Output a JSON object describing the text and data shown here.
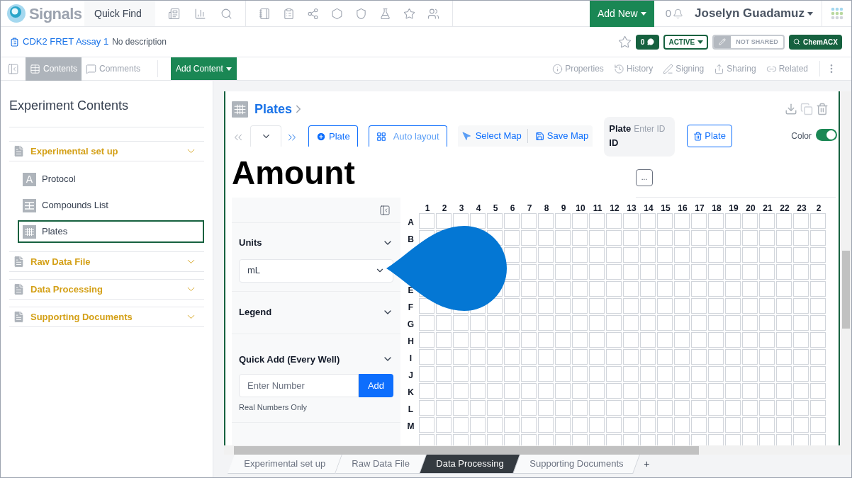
{
  "topbar": {
    "brand": "Signals",
    "quick_find": "Quick Find",
    "add_new": "Add New",
    "notifications": "0",
    "user": "Joselyn Guadamuz"
  },
  "header": {
    "title": "CDK2 FRET Assay 1",
    "description": "No description",
    "comments": "0",
    "status": "ACTIVE",
    "sharing": "NOT SHARED",
    "search_button": "ChemACX"
  },
  "toolbar": {
    "tabs": [
      {
        "label": "Contents",
        "selected": true
      },
      {
        "label": "Comments",
        "selected": false
      }
    ],
    "add_content": "Add Content",
    "actions": [
      "Properties",
      "History",
      "Signing",
      "Sharing",
      "Related"
    ]
  },
  "sidebar": {
    "title": "Experiment Contents",
    "sections": [
      {
        "label": "Experimental set up",
        "children": [
          {
            "label": "Protocol",
            "kind": "text",
            "icon": "A",
            "selected": false
          },
          {
            "label": "Compounds List",
            "kind": "table",
            "selected": false
          },
          {
            "label": "Plates",
            "kind": "plate",
            "selected": true
          }
        ]
      },
      {
        "label": "Raw Data File"
      },
      {
        "label": "Data Processing"
      },
      {
        "label": "Supporting Documents"
      }
    ]
  },
  "plates": {
    "title": "Plates",
    "add_plate": "Plate",
    "auto_layout": "Auto layout",
    "select_map": "Select Map",
    "save_map": "Save Map",
    "plate_id_label": "Plate ID",
    "plate_id_placeholder": "Enter ID",
    "delete_plate": "Plate",
    "color_toggle": {
      "label": "Color",
      "on": true
    },
    "heading": "Amount",
    "more": "...",
    "panel": {
      "units": {
        "label": "Units",
        "value": "mL"
      },
      "legend": "Legend",
      "quick_add": {
        "label": "Quick Add (Every Well)",
        "placeholder": "Enter Number",
        "button": "Add",
        "hint": "Real Numbers Only"
      }
    },
    "columns": [
      "1",
      "2",
      "3",
      "4",
      "5",
      "6",
      "7",
      "8",
      "9",
      "10",
      "11",
      "12",
      "13",
      "14",
      "15",
      "16",
      "17",
      "18",
      "19",
      "20",
      "21",
      "22",
      "23",
      "2"
    ],
    "rows": [
      "A",
      "B",
      null,
      null,
      "E",
      "F",
      "G",
      "H",
      "I",
      "J",
      "K",
      "L",
      "M"
    ]
  },
  "sheet_tabs": [
    {
      "label": "Experimental set up",
      "selected": false
    },
    {
      "label": "Raw Data File",
      "selected": false
    },
    {
      "label": "Data Processing",
      "selected": true
    },
    {
      "label": "Supporting Documents",
      "selected": false
    }
  ],
  "add_tab": "+"
}
